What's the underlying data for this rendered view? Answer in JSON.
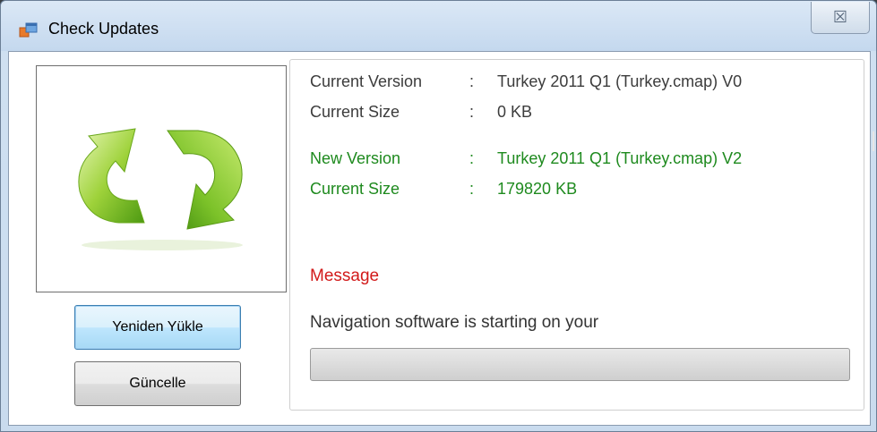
{
  "window": {
    "title": "Check Updates",
    "close_glyph": "☒"
  },
  "icons": {
    "app": "app-window-icon",
    "refresh": "green-refresh-arrows-icon"
  },
  "buttons": {
    "reload_label": "Yeniden Yükle",
    "update_label": "Güncelle"
  },
  "info": {
    "current_version_label": "Current Version",
    "current_version_value": "Turkey 2011 Q1 (Turkey.cmap) V0",
    "current_size_label": "Current Size",
    "current_size_value": "0 KB",
    "new_version_label": "New Version",
    "new_version_value": "Turkey 2011 Q1 (Turkey.cmap) V2",
    "new_size_label": "Current Size",
    "new_size_value": "179820 KB",
    "colon": ":"
  },
  "message": {
    "title": "Message",
    "text": "Navigation software is starting on your"
  },
  "progress": {
    "value": 0
  },
  "colors": {
    "new_info": "#1e8a1e",
    "message_title": "#d21a1a"
  }
}
